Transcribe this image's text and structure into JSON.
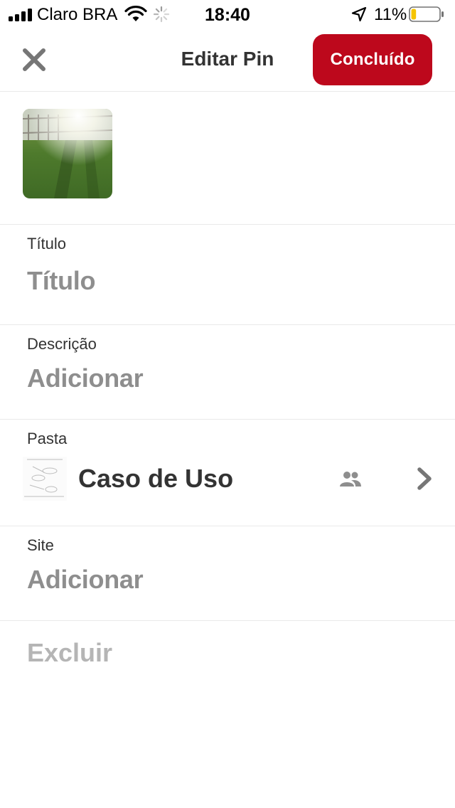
{
  "status_bar": {
    "carrier": "Claro BRA",
    "time": "18:40",
    "battery_percent": "11%",
    "battery_level": 0.11,
    "battery_color": "#f5c400",
    "icons": [
      "signal-icon",
      "wifi-icon",
      "activity-spinner-icon",
      "location-arrow-icon",
      "battery-icon"
    ]
  },
  "nav": {
    "title": "Editar Pin",
    "close_icon": "close-icon",
    "done_label": "Concluído",
    "accent_color": "#bd081c"
  },
  "pin": {
    "image_icon": "pin-image"
  },
  "fields": {
    "title": {
      "label": "Título",
      "placeholder": "Título"
    },
    "description": {
      "label": "Descrição",
      "placeholder": "Adicionar"
    },
    "board": {
      "label": "Pasta",
      "name": "Caso de Uso",
      "collaborators_icon": "group-icon",
      "chevron_icon": "chevron-right-icon"
    },
    "site": {
      "label": "Site",
      "placeholder": "Adicionar"
    }
  },
  "delete_label": "Excluir"
}
